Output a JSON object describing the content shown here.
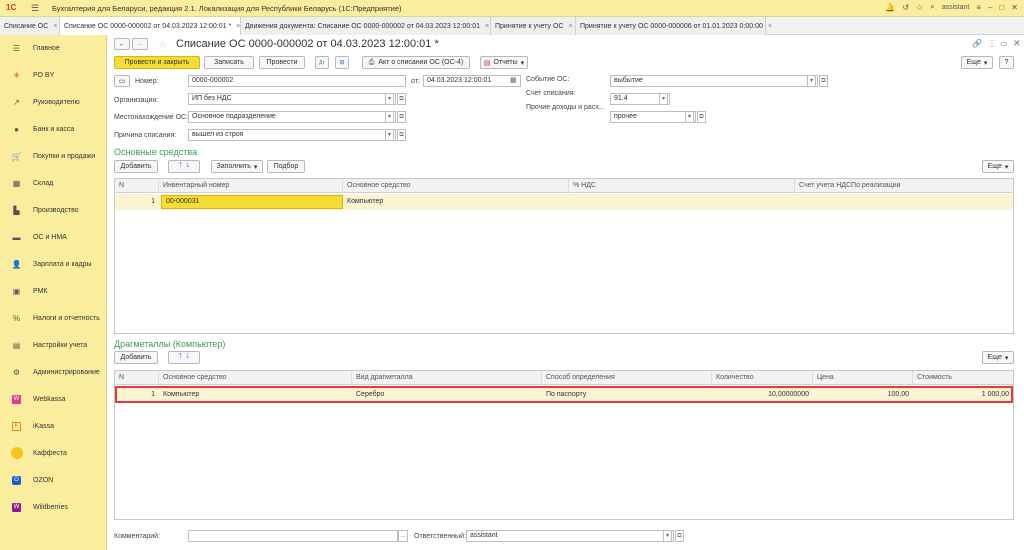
{
  "app": {
    "title": "Бухгалтерия для Беларуси, редакция 2.1. Локализация для Республики Беларусь (1С:Предприятие)",
    "user": "assistant",
    "logo": "1С"
  },
  "tabs": [
    {
      "label": "Списание ОС",
      "close": "×"
    },
    {
      "label": "Списание ОС 0000-000002 от 04.03.2023 12:00:01 *",
      "close": "×"
    },
    {
      "label": "Движения документа: Списание ОС 0000-000002 от 04.03.2023 12:00:01",
      "close": "×"
    },
    {
      "label": "Принятие к учету ОС",
      "close": "×"
    },
    {
      "label": "Принятие к учету ОС 0000-000006 от 01.01.2023 0:00:00",
      "close": "×"
    }
  ],
  "sidebar": {
    "items": [
      {
        "label": "Главное",
        "icon": "menu-icon"
      },
      {
        "label": "РО BY",
        "icon": "star-icon"
      },
      {
        "label": "Руководителю",
        "icon": "chart-line-icon"
      },
      {
        "label": "Банк и касса",
        "icon": "coin-icon"
      },
      {
        "label": "Покупки и продажи",
        "icon": "cart-icon"
      },
      {
        "label": "Склад",
        "icon": "grid-icon"
      },
      {
        "label": "Производство",
        "icon": "factory-icon"
      },
      {
        "label": "ОС и НМА",
        "icon": "truck-icon"
      },
      {
        "label": "Зарплата и кадры",
        "icon": "person-icon"
      },
      {
        "label": "РМК",
        "icon": "register-icon"
      },
      {
        "label": "Налоги и отчетность",
        "icon": "percent-icon"
      },
      {
        "label": "Настройки учета",
        "icon": "book-icon"
      },
      {
        "label": "Администрирование",
        "icon": "gear-icon"
      },
      {
        "label": "Webkassa",
        "icon": "webkassa-icon"
      },
      {
        "label": "iKassa",
        "icon": "ikassa-icon"
      },
      {
        "label": "Каффеста",
        "icon": "kaffesta-icon"
      },
      {
        "label": "OZON",
        "icon": "ozon-icon"
      },
      {
        "label": "Wildberries",
        "icon": "wildberries-icon"
      }
    ]
  },
  "form": {
    "title": "Списание ОС 0000-000002 от 04.03.2023 12:00:01 *",
    "toolbar": {
      "post_close": "Провести и закрыть",
      "save": "Записать",
      "post": "Провести",
      "act": "Акт о списании ОС (ОС-4)",
      "reports": "Отчеты",
      "more": "Еще",
      "help": "?"
    },
    "number_label": "Номер:",
    "number_value": "0000-000002",
    "date_label": "от:",
    "date_value": "04.03.2023 12:00:01",
    "org_label": "Организация:",
    "org_value": "ИП без НДС",
    "location_label": "Местонахождение ОС:",
    "location_value": "Основное подразделение",
    "reason_label": "Причина списания:",
    "reason_value": "вышел из строя",
    "event_label": "Событие ОС:",
    "event_value": "выбытие",
    "account_label": "Счет списания:",
    "account_value": "91.4",
    "other_label": "Прочие доходы и расх...",
    "other_value": "прочее"
  },
  "assets": {
    "title": "Основные средства",
    "add": "Добавить",
    "fill": "Заполнить",
    "select": "Подбор",
    "more": "Еще",
    "columns": [
      "N",
      "Инвентарный номер",
      "Основное средство",
      "% НДС",
      "Счет учета НДСПо реализации"
    ],
    "rows": [
      {
        "n": "1",
        "inv": "00-000031",
        "asset": "Компьютер",
        "vat": "",
        "account": ""
      }
    ]
  },
  "metals": {
    "title": "Драгметаллы (Компьютер)",
    "add": "Добавить",
    "more": "Еще",
    "columns": [
      "N",
      "Основное средство",
      "Вид драгметалла",
      "Способ определения",
      "Количество",
      "Цена",
      "Стоимость"
    ],
    "rows": [
      {
        "n": "1",
        "asset": "Компьютер",
        "metal": "Серебро",
        "method": "По паспорту",
        "qty": "10,00000000",
        "price": "100,00",
        "cost": "1 000,00"
      }
    ]
  },
  "footer": {
    "comment_label": "Комментарий:",
    "comment_value": "",
    "responsible_label": "Ответственный:",
    "responsible_value": "assistant"
  }
}
